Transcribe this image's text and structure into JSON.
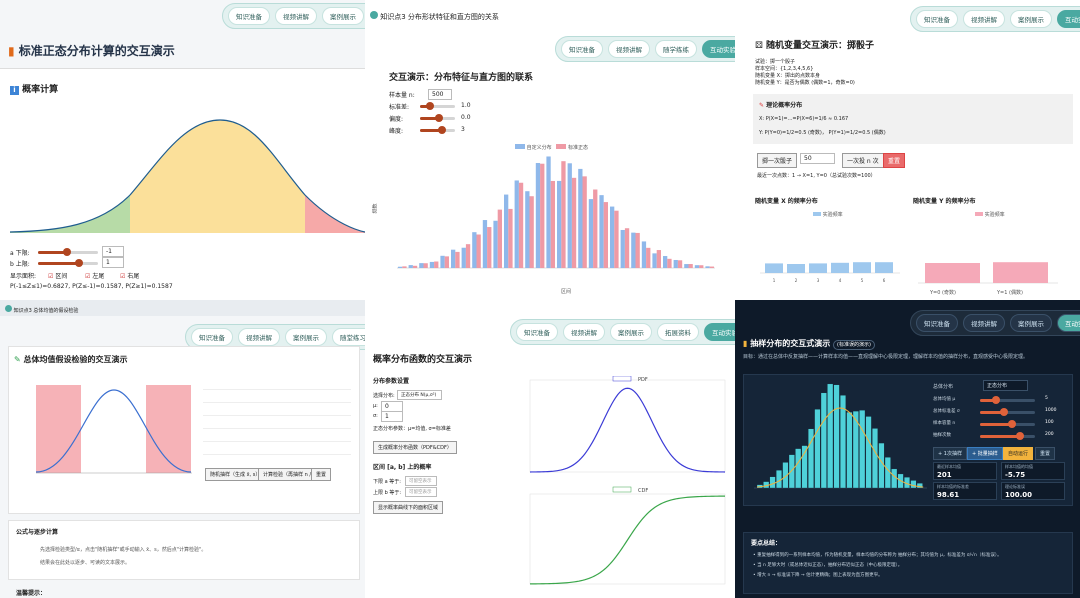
{
  "nav_main": [
    "知识准备",
    "视频讲解",
    "案例展示",
    "随堂练习",
    "互动实验"
  ],
  "nav_short": [
    "知识准备",
    "视频讲解",
    "案例展示",
    "随学"
  ],
  "nav_p2": [
    "知识准备",
    "视频讲解",
    "随学练练",
    "互动实验"
  ],
  "nav_p5": [
    "知识准备",
    "视频讲解",
    "案例展示",
    "拓展资料",
    "互动实验"
  ],
  "nav_p6": [
    "知识准备",
    "视频讲解",
    "案例展示",
    "互动实验",
    "互动实验"
  ],
  "p1": {
    "title": "标准正态分布计算的交互演示",
    "section": "概率计算",
    "a_label": "a 下限:",
    "a_val": "-1",
    "b_label": "b 上限:",
    "b_val": "1",
    "show_label": "显示面积:",
    "chk1": "区间",
    "chk2": "左尾",
    "chk3": "右尾",
    "result": "P(-1≤Z≤1)=0.6827,  P(Z≤-1)=0.1587,  P(Z≥1)=0.1587"
  },
  "p2": {
    "crumb": "知识点3 分布形状特征和直方图的关系",
    "title": "交互演示：分布特征与直方图的联系",
    "n_label": "样本量 n:",
    "n_val": "500",
    "sd_label": "标准差:",
    "sd_val": "1.0",
    "skew_label": "偏度:",
    "skew_val": "0.0",
    "kurt_label": "峰度:",
    "kurt_val": "3",
    "legend1": "自定义分布",
    "legend2": "标准正态",
    "ylabel": "频数",
    "xlabel": "区间"
  },
  "p3": {
    "title": "随机变量交互演示：掷骰子",
    "l1": "试验：掷一个骰子",
    "l2": "样本空间：{1,2,3,4,5,6}",
    "l3": "随机变量 X：掷出的点数本身",
    "l4": "随机变量 Y：是否为偶数 (偶数=1，奇数=0)",
    "theory": "理论概率分布",
    "tx": "X:  P(X=1)=...=P(X=6)=1/6 ≈ 0.167",
    "ty": "Y:  P(Y=0)=1/2=0.5  (奇数)，  P(Y=1)=1/2=0.5  (偶数)",
    "btn1": "掷一次骰子",
    "count": "50",
    "btn2": "一次投 n 次",
    "btn3": "重置",
    "last": "最近一次点数：1 → X=1, Y=0（总试验次数=100）",
    "chartx": "随机变量 X 的频率分布",
    "charty": "随机变量 Y 的频率分布",
    "legx": "实验频率",
    "legy": "实验频率",
    "yx0": "Y=0 (奇数)",
    "yx1": "Y=1 (偶数)"
  },
  "p4": {
    "crumb": "知识点3 总体均值的假设检验",
    "title": "总体均值假设检验的交互演示",
    "section": "公式与逐步计算",
    "s1": "先选择检验类型/α，点击\"随机抽样\"或手动输入 x̄、s，然后点\"计算检验\"。",
    "s2": "结果会在此处以逐步、可读的文本展示。",
    "tip": "温馨提示：",
    "btn_sample": "随机抽样（生成 x̄, s）",
    "btn_calc": "计算检验（再抽样 n / α）",
    "btn_reset": "重置"
  },
  "p5": {
    "title": "概率分布函数的交互演示",
    "settings": "分布参数设置",
    "dist_label": "选择分布:",
    "dist_val": "正态分布 N(μ,σ²)",
    "mu_label": "μ:",
    "mu_val": "0",
    "sigma_label": "σ:",
    "sigma_val": "1",
    "note": "正态分布参数：μ=均值, σ=标准差",
    "gen_btn": "生成概率分布函数（PDF&CDF）",
    "interval": "区间 [a, b] 上的概率",
    "a_label": "下限 a 等于:",
    "b_label": "上限 b 等于:",
    "ph": "可留空表示",
    "show_btn": "显示概率曲线下的面积区域",
    "pdf": "PDF",
    "cdf": "CDF"
  },
  "p6": {
    "title": "抽样分布的交互式演示",
    "badge": "(标准误的演示)",
    "desc": "目标：通过在总体中反复抽样——计算样本均值——直观理解中心极限定理，理解样本均值的抽样分布，直观感受中心极限定理。",
    "dist_label": "总体分布",
    "dist_val": "正态分布",
    "r1": "总体均值 μ",
    "r2": "总体标准差 σ",
    "r3": "样本容量 n",
    "r4": "抽样次数",
    "v1": "5",
    "v2": "1000",
    "v3": "100",
    "v4": "200",
    "b1": "+ 1次抽样",
    "b2": "+ 批量抽样",
    "b3": "自动运行",
    "b4": "重置",
    "m1": "最近样本均值",
    "m1v": "201",
    "m2": "样本均值的均值",
    "m2v": "-5.75",
    "m3": "样本均值的标准差",
    "m3v": "98.61",
    "m4": "理论标准误",
    "m4v": "100.00",
    "points": "要点总结：",
    "pt1": "重复抽样得到的一系列样本均值，作为随机变量，样本均值的分布称为 抽样分布；其均值为 μ，标准差为 σ/√n（标准误）。",
    "pt2": "当 n 足够大时（或总体近似正态），抽样分布近似正态（中心极限定理）。",
    "pt3": "增大 n → 标准误下降 → 估计更精确；图上表现为直方图更窄。"
  }
}
